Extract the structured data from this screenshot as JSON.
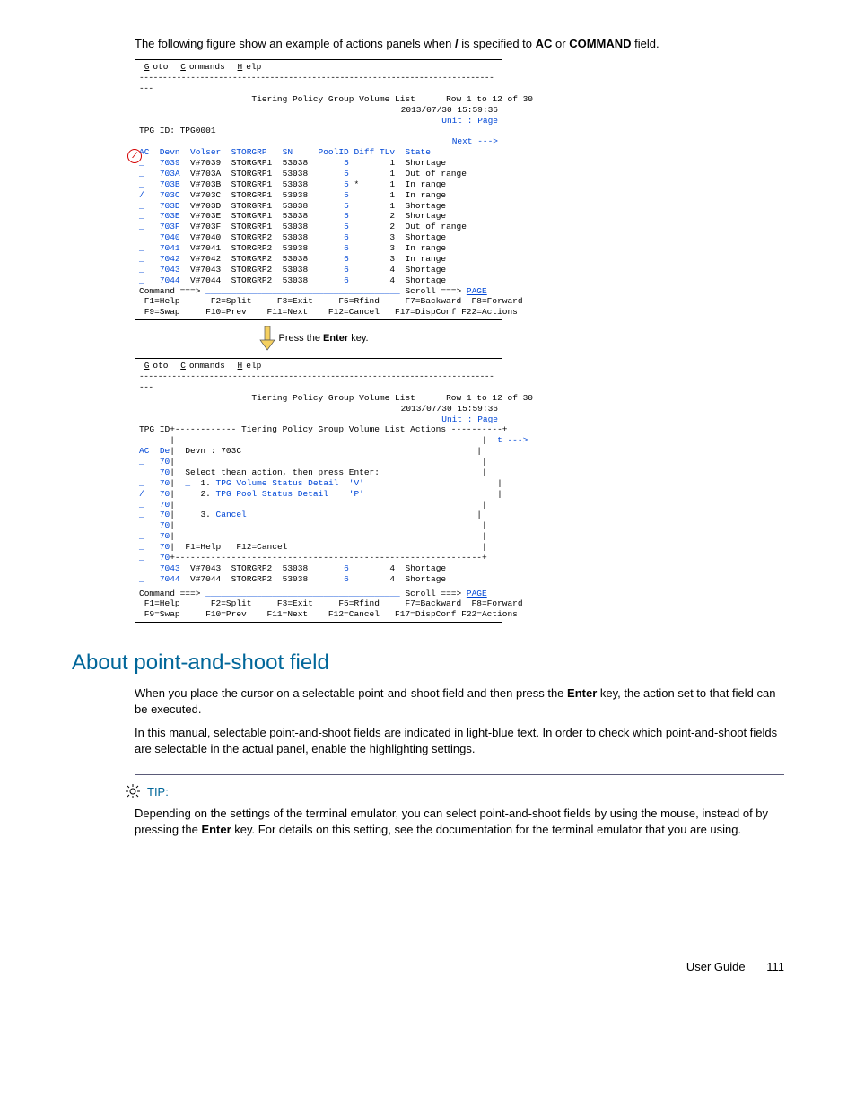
{
  "intro": {
    "part1": "The following figure show an example of actions panels when ",
    "slash": "/",
    "part2": " is specified to ",
    "ac": "AC",
    "or": " or ",
    "command": "COMMAND",
    "part3": " field."
  },
  "panel1": {
    "menu_goto": "Goto",
    "menu_commands": "Commands",
    "menu_help": "Help",
    "title": "Tiering Policy Group Volume List",
    "rowinfo": "Row 1 to 12 of 30",
    "timestamp": "2013/07/30 15:59:36",
    "unit": "Unit : Page",
    "tpg_id": "TPG ID: TPG0001",
    "next": "Next --->",
    "headers": {
      "ac": "AC",
      "devn": "Devn",
      "volser": "Volser",
      "storgrp": "STORGRP",
      "sn": "SN",
      "poolid": "PoolID",
      "diff": "Diff",
      "tlv": "TLv",
      "state": "State"
    },
    "rows": [
      {
        "ac": "_",
        "devn": "7039",
        "volser": "V#7039",
        "storgrp": "STORGRP1",
        "sn": "53038",
        "poolid": "5",
        "diff": "",
        "tlv": "1",
        "state": "Shortage"
      },
      {
        "ac": "_",
        "devn": "703A",
        "volser": "V#703A",
        "storgrp": "STORGRP1",
        "sn": "53038",
        "poolid": "5",
        "diff": "",
        "tlv": "1",
        "state": "Out of range"
      },
      {
        "ac": "_",
        "devn": "703B",
        "volser": "V#703B",
        "storgrp": "STORGRP1",
        "sn": "53038",
        "poolid": "5",
        "diff": "*",
        "tlv": "1",
        "state": "In range"
      },
      {
        "ac": "/",
        "devn": "703C",
        "volser": "V#703C",
        "storgrp": "STORGRP1",
        "sn": "53038",
        "poolid": "5",
        "diff": "",
        "tlv": "1",
        "state": "In range"
      },
      {
        "ac": "_",
        "devn": "703D",
        "volser": "V#703D",
        "storgrp": "STORGRP1",
        "sn": "53038",
        "poolid": "5",
        "diff": "",
        "tlv": "1",
        "state": "Shortage"
      },
      {
        "ac": "_",
        "devn": "703E",
        "volser": "V#703E",
        "storgrp": "STORGRP1",
        "sn": "53038",
        "poolid": "5",
        "diff": "",
        "tlv": "2",
        "state": "Shortage"
      },
      {
        "ac": "_",
        "devn": "703F",
        "volser": "V#703F",
        "storgrp": "STORGRP1",
        "sn": "53038",
        "poolid": "5",
        "diff": "",
        "tlv": "2",
        "state": "Out of range"
      },
      {
        "ac": "_",
        "devn": "7040",
        "volser": "V#7040",
        "storgrp": "STORGRP2",
        "sn": "53038",
        "poolid": "6",
        "diff": "",
        "tlv": "3",
        "state": "Shortage"
      },
      {
        "ac": "_",
        "devn": "7041",
        "volser": "V#7041",
        "storgrp": "STORGRP2",
        "sn": "53038",
        "poolid": "6",
        "diff": "",
        "tlv": "3",
        "state": "In range"
      },
      {
        "ac": "_",
        "devn": "7042",
        "volser": "V#7042",
        "storgrp": "STORGRP2",
        "sn": "53038",
        "poolid": "6",
        "diff": "",
        "tlv": "3",
        "state": "In range"
      },
      {
        "ac": "_",
        "devn": "7043",
        "volser": "V#7043",
        "storgrp": "STORGRP2",
        "sn": "53038",
        "poolid": "6",
        "diff": "",
        "tlv": "4",
        "state": "Shortage"
      },
      {
        "ac": "_",
        "devn": "7044",
        "volser": "V#7044",
        "storgrp": "STORGRP2",
        "sn": "53038",
        "poolid": "6",
        "diff": "",
        "tlv": "4",
        "state": "Shortage"
      }
    ],
    "command_label": "Command ===>",
    "scroll": "Scroll ===> ",
    "page": "PAGE",
    "fkeys_line1": " F1=Help      F2=Split     F3=Exit     F5=Rfind     F7=Backward  F8=Forward",
    "fkeys_line2": " F9=Swap     F10=Prev    F11=Next    F12=Cancel   F17=DispConf F22=Actions"
  },
  "arrow_caption": {
    "press": "Press the ",
    "enter": "Enter",
    "key": " key."
  },
  "panel2": {
    "menu_goto": "Goto",
    "menu_commands": "Commands",
    "menu_help": "Help",
    "title": "Tiering Policy Group Volume List",
    "rowinfo": "Row 1 to 12 of 30",
    "timestamp": "2013/07/30 15:59:36",
    "unit": "Unit : Page",
    "tpg_id_label": "TPG ID",
    "actions_title": "Tiering Policy Group Volume List Actions",
    "t_arrow": "t --->",
    "ac": "AC",
    "de": "De",
    "devn_label": "Devn : 703C",
    "left_devns": [
      "70",
      "70",
      "70",
      "70",
      "70",
      "70",
      "70",
      "70",
      "70"
    ],
    "select_line": "Select thean action, then press Enter:",
    "opt_marker": "_",
    "opt1_num": "1.",
    "opt1": "TPG Volume Status Detail  'V'",
    "opt2_num": "2.",
    "opt2": "TPG Pool Status Detail    'P'",
    "opt3_num": "3.",
    "opt3": "Cancel",
    "fkeys_popup": "F1=Help   F12=Cancel",
    "bottom_rows": [
      {
        "ac": "_",
        "devn": "7043",
        "volser": "V#7043",
        "storgrp": "STORGRP2",
        "sn": "53038",
        "poolid": "6",
        "tlv": "4",
        "state": "Shortage"
      },
      {
        "ac": "_",
        "devn": "7044",
        "volser": "V#7044",
        "storgrp": "STORGRP2",
        "sn": "53038",
        "poolid": "6",
        "tlv": "4",
        "state": "Shortage"
      }
    ],
    "command_label": "Command ===>",
    "scroll": "Scroll ===> ",
    "page": "PAGE",
    "fkeys_line1": " F1=Help      F2=Split     F3=Exit     F5=Rfind     F7=Backward  F8=Forward",
    "fkeys_line2": " F9=Swap     F10=Prev    F11=Next    F12=Cancel   F17=DispConf F22=Actions"
  },
  "section_heading": "About point-and-shoot field",
  "para1": {
    "a": "When you place the cursor on a selectable point-and-shoot field and then press the ",
    "enter": "Enter",
    "b": " key, the action set to that field can be executed."
  },
  "para2": "In this manual, selectable point-and-shoot fields are indicated in light-blue text. In order to check which point-and-shoot fields are selectable in the actual panel, enable the highlighting settings.",
  "tip": {
    "label": "TIP:",
    "a": "Depending on the settings of the terminal emulator, you can select point-and-shoot fields by using the mouse, instead of by pressing the ",
    "enter": "Enter",
    "b": " key. For details on this setting, see the documentation for the terminal emulator that you are using."
  },
  "footer": {
    "guide": "User Guide",
    "page": "111"
  }
}
